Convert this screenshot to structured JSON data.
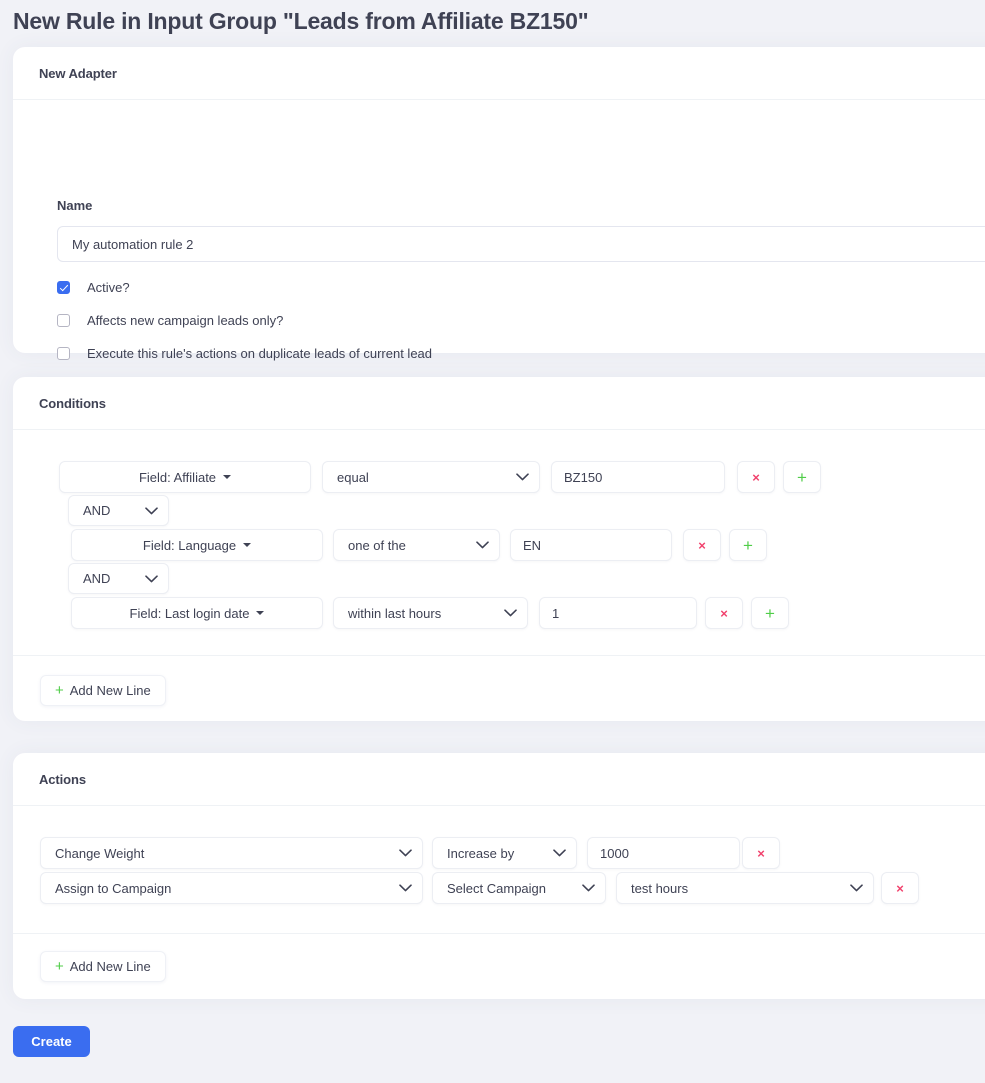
{
  "page": {
    "title": "New Rule in Input Group \"Leads from Affiliate BZ150\"",
    "background_color": "#f1f2f7",
    "accent_color": "#3a6df0",
    "danger_color": "#f1416c",
    "success_color": "#50cd48",
    "text_color": "#3f4254"
  },
  "adapter": {
    "card_title": "New Adapter",
    "name_label": "Name",
    "name_value": "My automation rule 2",
    "name_placeholder": "Name",
    "checkboxes": [
      {
        "label": "Active?",
        "checked": true
      },
      {
        "label": "Affects new campaign leads only?",
        "checked": false
      },
      {
        "label": "Execute this rule's actions on duplicate leads of current lead",
        "checked": false
      }
    ]
  },
  "conditions": {
    "card_title": "Conditions",
    "add_line_label": "Add New Line",
    "add_icon": "plus-icon",
    "remove_icon": "times-icon",
    "rows": [
      {
        "field": "Field: Affiliate",
        "operator": "equal",
        "value": "BZ150",
        "value_type": "text",
        "remove_label": "×",
        "add_label": "+"
      },
      {
        "field": "Field: Language",
        "operator": "one of the",
        "value": "EN",
        "value_type": "text",
        "remove_label": "×",
        "add_label": "+"
      },
      {
        "field": "Field: Last login date",
        "operator": "within last hours",
        "value": "1",
        "value_type": "text",
        "remove_label": "×",
        "add_label": "+"
      }
    ],
    "logic_operators": [
      "AND",
      "AND"
    ]
  },
  "actions": {
    "card_title": "Actions",
    "add_line_label": "Add New Line",
    "rows": [
      {
        "action": "Change Weight",
        "modifier": "Increase by",
        "value": "1000",
        "value_type": "text",
        "remove_label": "×"
      },
      {
        "action": "Assign to Campaign",
        "modifier": "Select Campaign",
        "value": "test hours",
        "value_type": "select",
        "remove_label": "×"
      }
    ]
  },
  "footer": {
    "create_label": "Create"
  }
}
